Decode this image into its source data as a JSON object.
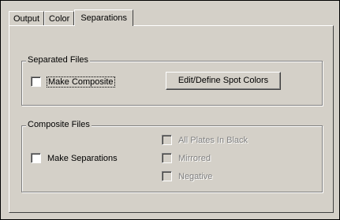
{
  "tabs": [
    {
      "label": "Output",
      "active": false
    },
    {
      "label": "Color",
      "active": false
    },
    {
      "label": "Separations",
      "active": true
    }
  ],
  "separated_files": {
    "title": "Separated Files",
    "make_composite": {
      "label": "Make Composite",
      "checked": false,
      "focused": true
    },
    "spot_colors_button": "Edit/Define Spot Colors"
  },
  "composite_files": {
    "title": "Composite Files",
    "make_separations": {
      "label": "Make Separations",
      "checked": false
    },
    "options": [
      {
        "label": "All Plates In Black",
        "checked": false,
        "enabled": false
      },
      {
        "label": "Mirrored",
        "checked": false,
        "enabled": false
      },
      {
        "label": "Negative",
        "checked": false,
        "enabled": false
      }
    ]
  },
  "colors": {
    "face": "#d4d0c8",
    "highlight": "#ffffff",
    "shadow": "#808080",
    "dark_shadow": "#404040",
    "disabled_text": "#808080"
  }
}
